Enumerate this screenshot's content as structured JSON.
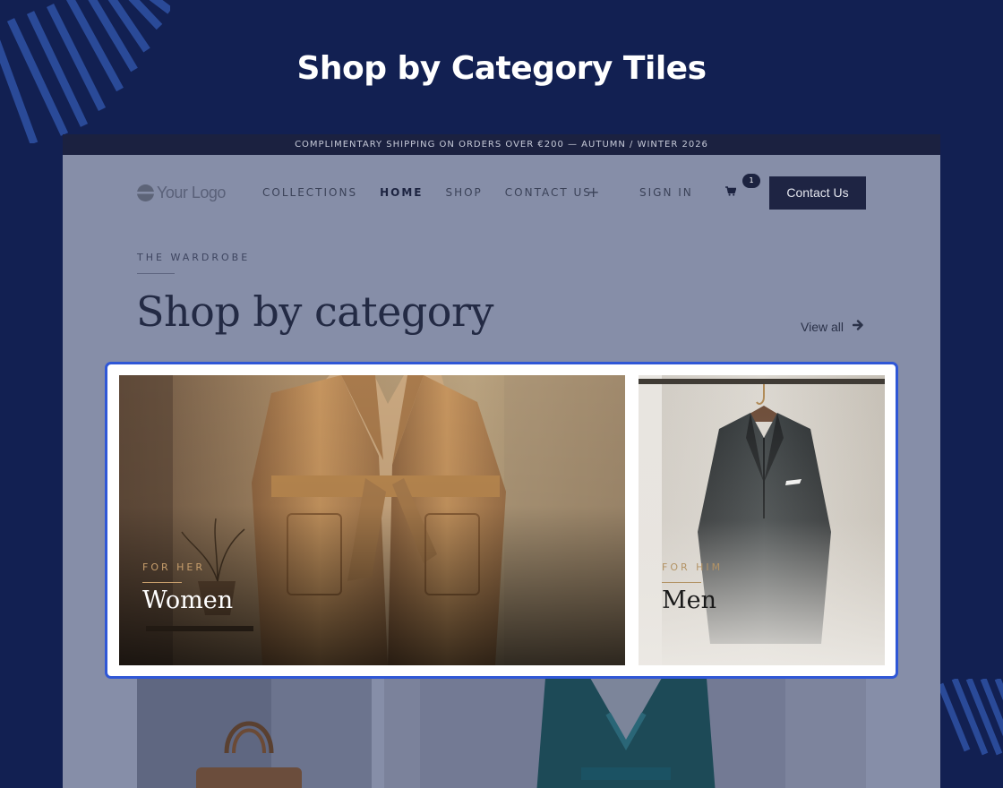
{
  "heading": "Shop by Category Tiles",
  "promo": "COMPLIMENTARY SHIPPING ON ORDERS OVER €200 — AUTUMN / WINTER 2026",
  "logo": "Your Logo",
  "nav": {
    "items": [
      "COLLECTIONS",
      "HOME",
      "SHOP",
      "CONTACT US"
    ],
    "plus": "+",
    "sign_in": "SIGN IN",
    "cart_icon": "cart-icon",
    "cart_count": "1",
    "cta": "Contact Us"
  },
  "section": {
    "eyebrow": "THE WARDROBE",
    "title": "Shop by category",
    "view_all": "View all",
    "view_all_icon": "arrow-right-icon"
  },
  "tiles": [
    {
      "eyebrow": "FOR HER",
      "name": "Women"
    },
    {
      "eyebrow": "FOR HIM",
      "name": "Men"
    }
  ],
  "colors": {
    "background": "#122052",
    "highlight": "#2f57d6",
    "accent_gold": "#c79e6c",
    "dark": "#1e2443"
  }
}
